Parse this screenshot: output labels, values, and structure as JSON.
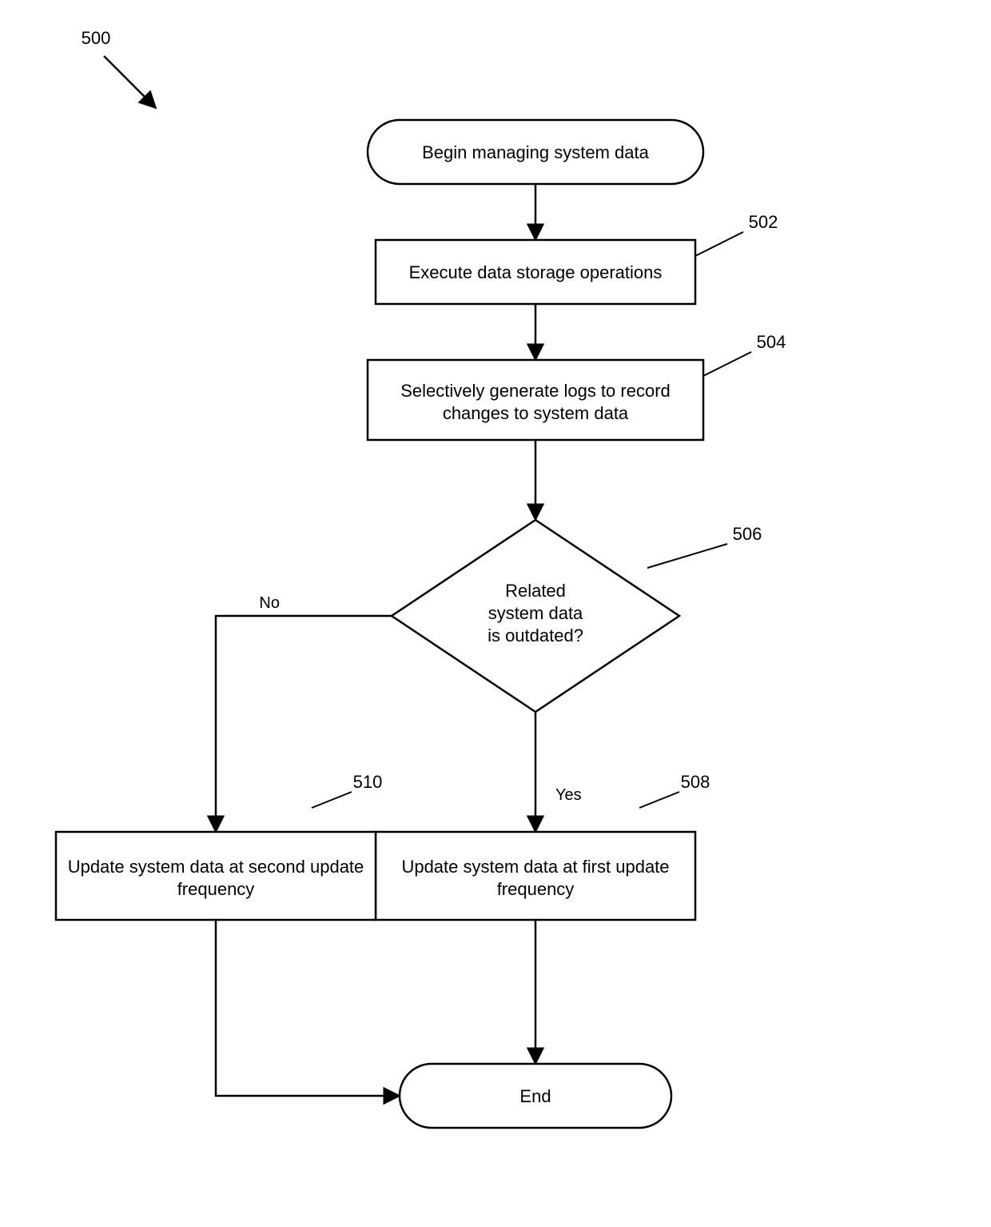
{
  "figure_ref": "500",
  "nodes": {
    "start": {
      "text": "Begin managing system data"
    },
    "exec": {
      "text": "Execute data storage operations",
      "ref": "502"
    },
    "logs": {
      "line1": "Selectively generate logs to record",
      "line2": "changes to system data",
      "ref": "504"
    },
    "dec": {
      "line1": "Related",
      "line2": "system data",
      "line3": "is outdated?",
      "ref": "506"
    },
    "first": {
      "line1": "Update system data at first update",
      "line2": "frequency",
      "ref": "508"
    },
    "second": {
      "line1": "Update system data at second update",
      "line2": "frequency",
      "ref": "510"
    },
    "end": {
      "text": "End"
    }
  },
  "edges": {
    "yes": "Yes",
    "no": "No"
  }
}
